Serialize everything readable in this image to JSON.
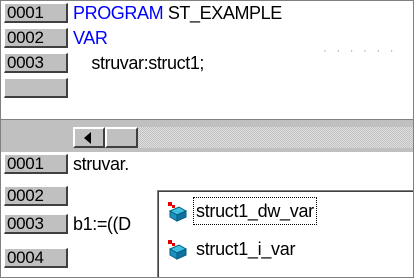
{
  "top_editor": {
    "lines": [
      {
        "number": "0001",
        "keyword": "PROGRAM",
        "text": " ST_EXAMPLE"
      },
      {
        "number": "0002",
        "keyword": "VAR",
        "text": ""
      },
      {
        "number": "0003",
        "keyword": "",
        "text": "    struvar:struct1;"
      }
    ],
    "dots": "· · · · · ·"
  },
  "bottom_editor": {
    "lines": [
      {
        "number": "0001",
        "text": "struvar."
      },
      {
        "number": "0002",
        "text": ""
      },
      {
        "number": "0003",
        "text": "b1:=((D"
      },
      {
        "number": "0004",
        "text": ""
      }
    ]
  },
  "autocomplete": {
    "items": [
      {
        "label": "struct1_dw_var",
        "icon": "variable-icon",
        "selected": true
      },
      {
        "label": "struct1_i_var",
        "icon": "variable-icon",
        "selected": false
      }
    ]
  },
  "colors": {
    "keyword": "#0000ff",
    "gutter": "#c0c0c0",
    "text": "#000000"
  }
}
